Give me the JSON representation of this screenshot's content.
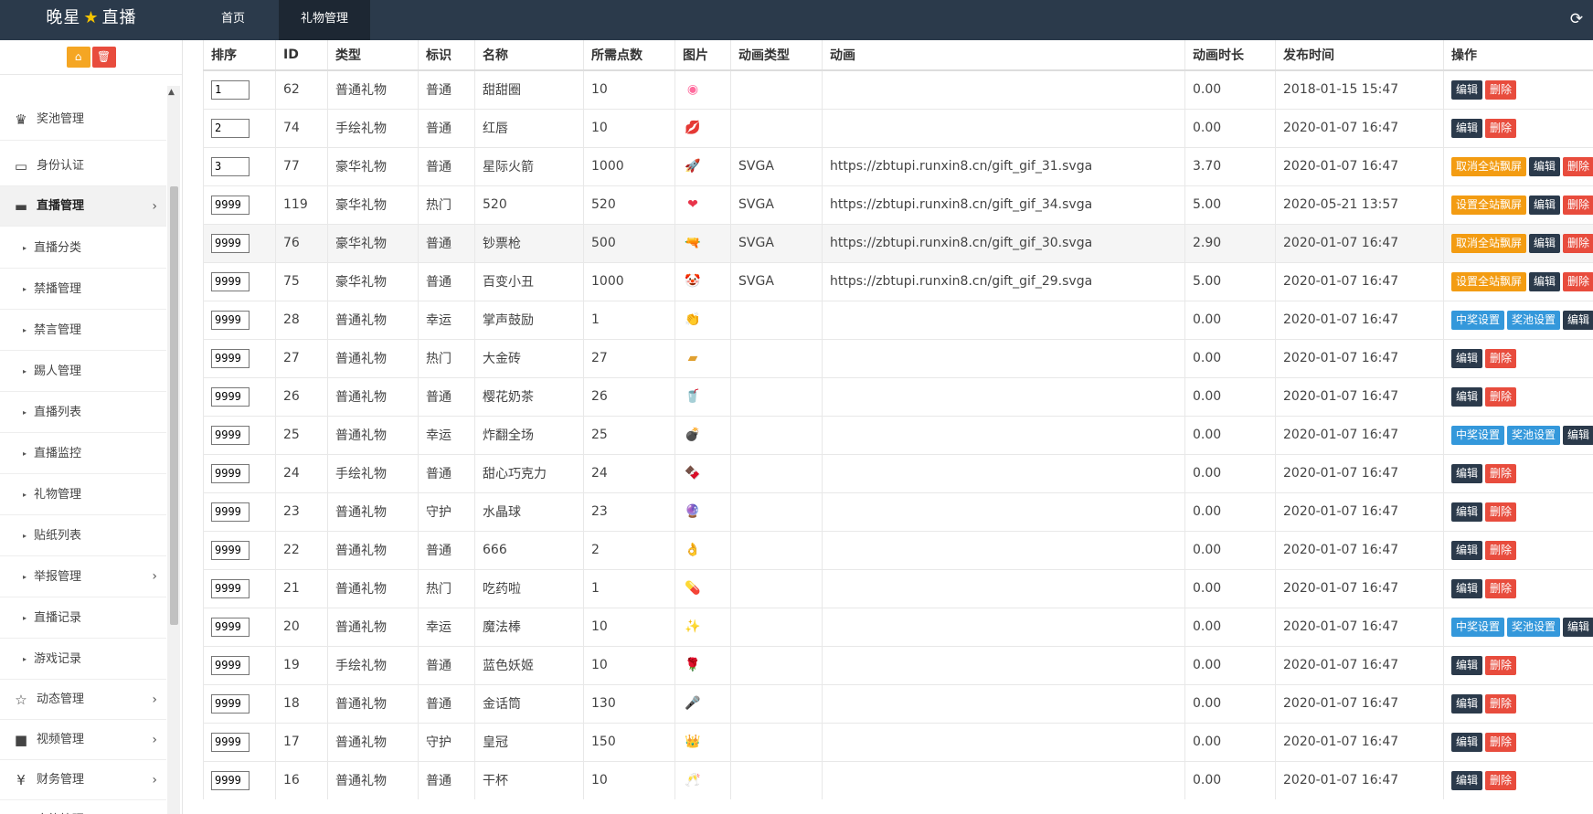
{
  "header": {
    "logo_left": "晚星",
    "logo_star": "★",
    "logo_right": "直播",
    "tabs": [
      "首页",
      "礼物管理"
    ],
    "refresh_icon": "refresh-icon"
  },
  "sidebar": {
    "tool_buttons": [
      "home-icon",
      "trash-icon"
    ],
    "items": [
      {
        "label": "奖池管理",
        "icon": "trophy-icon"
      },
      {
        "label": "身份认证",
        "icon": "monitor-icon"
      },
      {
        "label": "直播管理",
        "icon": "monitor-icon"
      },
      {
        "label": "直播分类"
      },
      {
        "label": "禁播管理"
      },
      {
        "label": "禁言管理"
      },
      {
        "label": "踢人管理"
      },
      {
        "label": "直播列表"
      },
      {
        "label": "直播监控"
      },
      {
        "label": "礼物管理"
      },
      {
        "label": "贴纸列表"
      },
      {
        "label": "举报管理"
      },
      {
        "label": "直播记录"
      },
      {
        "label": "游戏记录"
      },
      {
        "label": "动态管理",
        "icon": "star-icon"
      },
      {
        "label": "视频管理",
        "icon": "video-icon"
      },
      {
        "label": "财务管理",
        "icon": "yen-icon"
      },
      {
        "label": "家族管理",
        "icon": "bank-icon"
      }
    ]
  },
  "table": {
    "headers": [
      "排序",
      "ID",
      "类型",
      "标识",
      "名称",
      "所需点数",
      "图片",
      "动画类型",
      "动画",
      "动画时长",
      "发布时间",
      "操作"
    ],
    "rows": [
      {
        "sort": "1",
        "id": "62",
        "type": "普通礼物",
        "mark": "普通",
        "name": "甜甜圈",
        "points": "10",
        "img": "◉",
        "anim_type": "",
        "anim": "",
        "duration": "0.00",
        "time": "2018-01-15 15:47",
        "ops": [
          "编辑",
          "删除"
        ]
      },
      {
        "sort": "2",
        "id": "74",
        "type": "手绘礼物",
        "mark": "普通",
        "name": "红唇",
        "points": "10",
        "img": "💋",
        "anim_type": "",
        "anim": "",
        "duration": "0.00",
        "time": "2020-01-07 16:47",
        "ops": [
          "编辑",
          "删除"
        ]
      },
      {
        "sort": "3",
        "id": "77",
        "type": "豪华礼物",
        "mark": "普通",
        "name": "星际火箭",
        "points": "1000",
        "img": "🚀",
        "anim_type": "SVGA",
        "anim": "https://zbtupi.runxin8.cn/gift_gif_31.svga",
        "duration": "3.70",
        "time": "2020-01-07 16:47",
        "ops": [
          "取消全站飘屏",
          "编辑",
          "删除"
        ]
      },
      {
        "sort": "9999",
        "id": "119",
        "type": "豪华礼物",
        "mark": "热门",
        "name": "520",
        "points": "520",
        "img": "❤",
        "anim_type": "SVGA",
        "anim": "https://zbtupi.runxin8.cn/gift_gif_34.svga",
        "duration": "5.00",
        "time": "2020-05-21 13:57",
        "ops": [
          "设置全站飘屏",
          "编辑",
          "删除"
        ]
      },
      {
        "sort": "9999",
        "id": "76",
        "type": "豪华礼物",
        "mark": "普通",
        "name": "钞票枪",
        "points": "500",
        "img": "🔫",
        "anim_type": "SVGA",
        "anim": "https://zbtupi.runxin8.cn/gift_gif_30.svga",
        "duration": "2.90",
        "time": "2020-01-07 16:47",
        "ops": [
          "取消全站飘屏",
          "编辑",
          "删除"
        ]
      },
      {
        "sort": "9999",
        "id": "75",
        "type": "豪华礼物",
        "mark": "普通",
        "name": "百变小丑",
        "points": "1000",
        "img": "🤡",
        "anim_type": "SVGA",
        "anim": "https://zbtupi.runxin8.cn/gift_gif_29.svga",
        "duration": "5.00",
        "time": "2020-01-07 16:47",
        "ops": [
          "设置全站飘屏",
          "编辑",
          "删除"
        ]
      },
      {
        "sort": "9999",
        "id": "28",
        "type": "普通礼物",
        "mark": "幸运",
        "name": "掌声鼓励",
        "points": "1",
        "img": "👏",
        "anim_type": "",
        "anim": "",
        "duration": "0.00",
        "time": "2020-01-07 16:47",
        "ops": [
          "中奖设置",
          "奖池设置",
          "编辑"
        ]
      },
      {
        "sort": "9999",
        "id": "27",
        "type": "普通礼物",
        "mark": "热门",
        "name": "大金砖",
        "points": "27",
        "img": "▰",
        "anim_type": "",
        "anim": "",
        "duration": "0.00",
        "time": "2020-01-07 16:47",
        "ops": [
          "编辑",
          "删除"
        ]
      },
      {
        "sort": "9999",
        "id": "26",
        "type": "普通礼物",
        "mark": "普通",
        "name": "樱花奶茶",
        "points": "26",
        "img": "🥤",
        "anim_type": "",
        "anim": "",
        "duration": "0.00",
        "time": "2020-01-07 16:47",
        "ops": [
          "编辑",
          "删除"
        ]
      },
      {
        "sort": "9999",
        "id": "25",
        "type": "普通礼物",
        "mark": "幸运",
        "name": "炸翻全场",
        "points": "25",
        "img": "💣",
        "anim_type": "",
        "anim": "",
        "duration": "0.00",
        "time": "2020-01-07 16:47",
        "ops": [
          "中奖设置",
          "奖池设置",
          "编辑"
        ]
      },
      {
        "sort": "9999",
        "id": "24",
        "type": "手绘礼物",
        "mark": "普通",
        "name": "甜心巧克力",
        "points": "24",
        "img": "🍫",
        "anim_type": "",
        "anim": "",
        "duration": "0.00",
        "time": "2020-01-07 16:47",
        "ops": [
          "编辑",
          "删除"
        ]
      },
      {
        "sort": "9999",
        "id": "23",
        "type": "普通礼物",
        "mark": "守护",
        "name": "水晶球",
        "points": "23",
        "img": "🔮",
        "anim_type": "",
        "anim": "",
        "duration": "0.00",
        "time": "2020-01-07 16:47",
        "ops": [
          "编辑",
          "删除"
        ]
      },
      {
        "sort": "9999",
        "id": "22",
        "type": "普通礼物",
        "mark": "普通",
        "name": "666",
        "points": "2",
        "img": "👌",
        "anim_type": "",
        "anim": "",
        "duration": "0.00",
        "time": "2020-01-07 16:47",
        "ops": [
          "编辑",
          "删除"
        ]
      },
      {
        "sort": "9999",
        "id": "21",
        "type": "普通礼物",
        "mark": "热门",
        "name": "吃药啦",
        "points": "1",
        "img": "💊",
        "anim_type": "",
        "anim": "",
        "duration": "0.00",
        "time": "2020-01-07 16:47",
        "ops": [
          "编辑",
          "删除"
        ]
      },
      {
        "sort": "9999",
        "id": "20",
        "type": "普通礼物",
        "mark": "幸运",
        "name": "魔法棒",
        "points": "10",
        "img": "✨",
        "anim_type": "",
        "anim": "",
        "duration": "0.00",
        "time": "2020-01-07 16:47",
        "ops": [
          "中奖设置",
          "奖池设置",
          "编辑"
        ]
      },
      {
        "sort": "9999",
        "id": "19",
        "type": "手绘礼物",
        "mark": "普通",
        "name": "蓝色妖姬",
        "points": "10",
        "img": "🌹",
        "anim_type": "",
        "anim": "",
        "duration": "0.00",
        "time": "2020-01-07 16:47",
        "ops": [
          "编辑",
          "删除"
        ]
      },
      {
        "sort": "9999",
        "id": "18",
        "type": "普通礼物",
        "mark": "普通",
        "name": "金话筒",
        "points": "130",
        "img": "🎤",
        "anim_type": "",
        "anim": "",
        "duration": "0.00",
        "time": "2020-01-07 16:47",
        "ops": [
          "编辑",
          "删除"
        ]
      },
      {
        "sort": "9999",
        "id": "17",
        "type": "普通礼物",
        "mark": "守护",
        "name": "皇冠",
        "points": "150",
        "img": "👑",
        "anim_type": "",
        "anim": "",
        "duration": "0.00",
        "time": "2020-01-07 16:47",
        "ops": [
          "编辑",
          "删除"
        ]
      },
      {
        "sort": "9999",
        "id": "16",
        "type": "普通礼物",
        "mark": "普通",
        "name": "干杯",
        "points": "10",
        "img": "🥂",
        "anim_type": "",
        "anim": "",
        "duration": "0.00",
        "time": "2020-01-07 16:47",
        "ops": [
          "编辑",
          "删除"
        ]
      }
    ]
  },
  "colors": {
    "topbar": "#2b3a4b",
    "edit": "#2b3a4b",
    "delete": "#e84c3d",
    "orange": "#f39c12",
    "blue": "#3498db"
  }
}
